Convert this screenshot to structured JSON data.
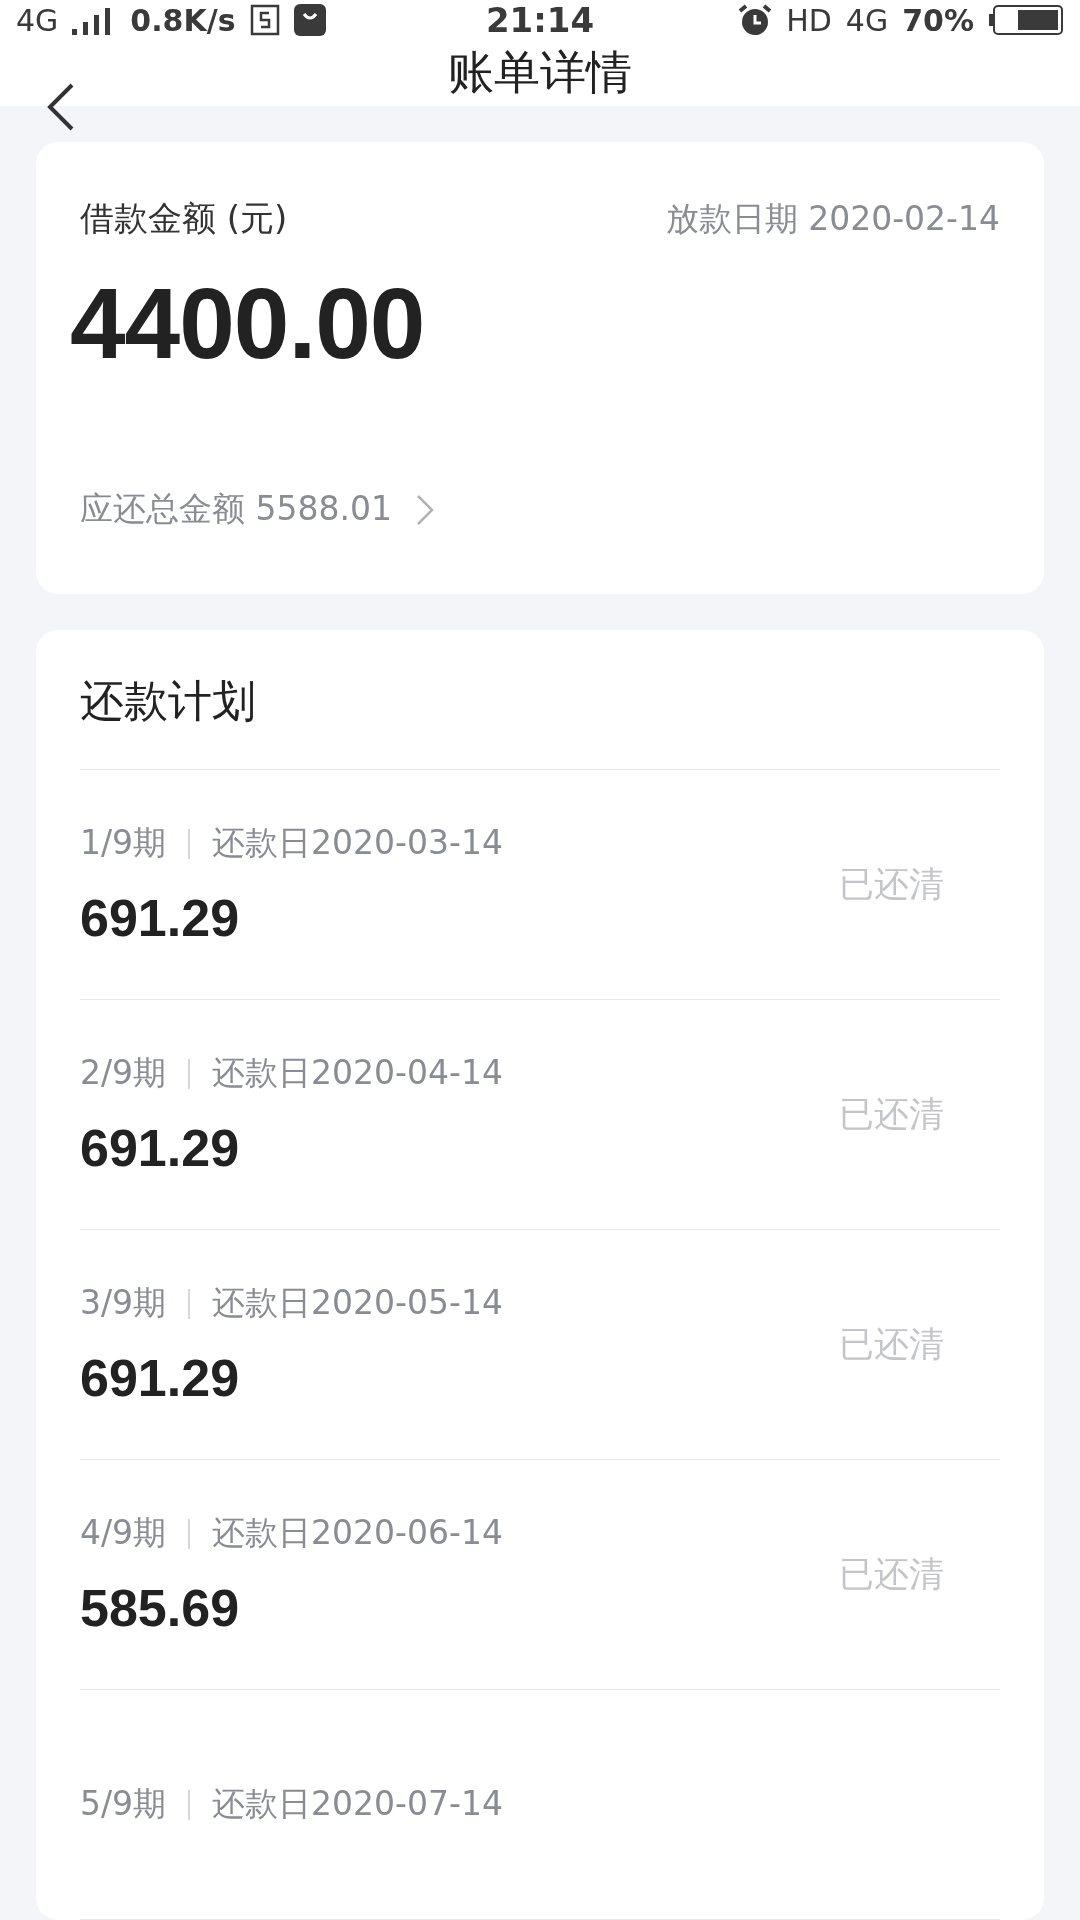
{
  "status_bar": {
    "network": "4G",
    "speed": "0.8K/s",
    "time": "21:14",
    "hd": "HD",
    "data": "4G",
    "battery": "70%"
  },
  "nav": {
    "title": "账单详情"
  },
  "loan": {
    "label": "借款金额 (元)",
    "date": "放款日期 2020-02-14",
    "amount": "4400.00",
    "total": "应还总金额 5588.01"
  },
  "plan": {
    "title": "还款计划",
    "rows": [
      {
        "period": "1/9期",
        "date": "还款日2020-03-14",
        "amount": "691.29",
        "status": "已还清"
      },
      {
        "period": "2/9期",
        "date": "还款日2020-04-14",
        "amount": "691.29",
        "status": "已还清"
      },
      {
        "period": "3/9期",
        "date": "还款日2020-05-14",
        "amount": "691.29",
        "status": "已还清"
      },
      {
        "period": "4/9期",
        "date": "还款日2020-06-14",
        "amount": "585.69",
        "status": "已还清"
      },
      {
        "period": "5/9期",
        "date": "还款日2020-07-14"
      }
    ]
  }
}
